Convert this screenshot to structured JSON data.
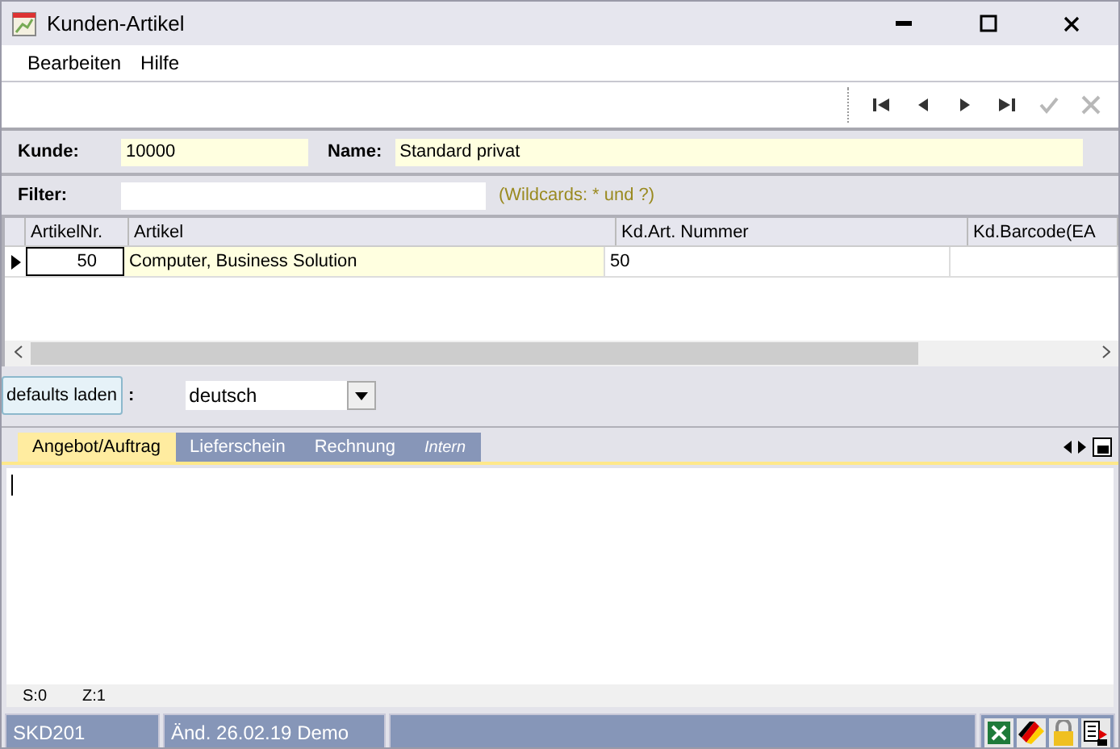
{
  "window": {
    "title": "Kunden-Artikel"
  },
  "menu": [
    {
      "label": "Bearbeiten"
    },
    {
      "label": "Hilfe"
    }
  ],
  "toolbar": [
    {
      "kind": "first",
      "disabled": false
    },
    {
      "kind": "prev",
      "disabled": false
    },
    {
      "kind": "next",
      "disabled": false
    },
    {
      "kind": "last",
      "disabled": false
    },
    {
      "kind": "ok",
      "disabled": true
    },
    {
      "kind": "cancel",
      "disabled": true
    }
  ],
  "customer": {
    "label": "Kunde:",
    "value": "10000",
    "name_label": "Name:",
    "name_value": "Standard privat"
  },
  "filter": {
    "label": "Filter:",
    "hint": "(Wildcards: * und ?)"
  },
  "table": {
    "columns": [
      "ArtikelNr.",
      "Artikel",
      "Kd.Art. Nummer",
      "Kd.Barcode(EA"
    ],
    "rows": [
      {
        "selected": true,
        "cells": [
          "50",
          "Computer, Business Solution",
          "50",
          ""
        ]
      }
    ]
  },
  "defaults": {
    "button": "defaults laden",
    "separator": ":",
    "language": "deutsch"
  },
  "tabs": [
    {
      "label": "Angebot/Auftrag",
      "selected": true,
      "italic": false
    },
    {
      "label": "Lieferschein",
      "selected": false,
      "italic": false
    },
    {
      "label": "Rechnung",
      "selected": false,
      "italic": false
    },
    {
      "label": "Intern",
      "selected": false,
      "italic": true
    }
  ],
  "editor": {
    "column": "S:0",
    "line": "Z:1"
  },
  "status_bar": [
    "SKD201",
    "Änd. 26.02.19 Demo"
  ]
}
